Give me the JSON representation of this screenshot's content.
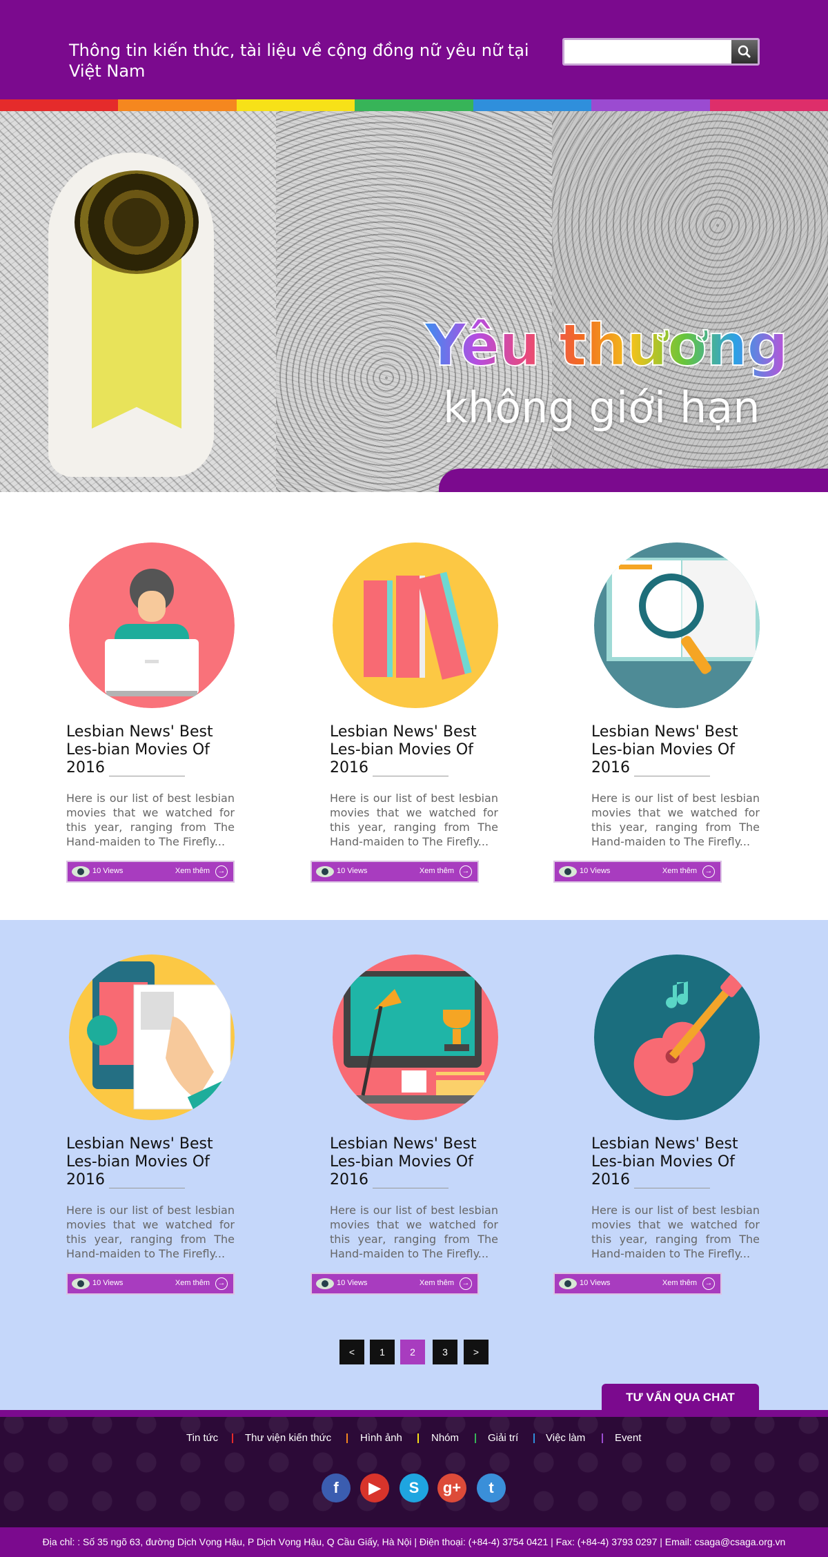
{
  "header": {
    "tagline": "Thông tin kiến thức, tài liệu về cộng đồng nữ yêu nữ tại Việt Nam",
    "search_placeholder": ""
  },
  "rainbow_colors": [
    "#e52b2b",
    "#f5871f",
    "#f7e118",
    "#37b458",
    "#2f8fdc",
    "#9b4bd1",
    "#de2e6a"
  ],
  "hero": {
    "line1": "Yêu thương",
    "line2": "không giới hạn"
  },
  "cards": [
    {
      "title": "Lesbian News' Best Les-bian Movies Of 2016",
      "desc": "Here is our list of best lesbian movies that we watched for this year, ranging from The Hand-maiden to The Firefly...",
      "views": "10 Views",
      "more": "Xem thêm",
      "icon": "woman-laptop-icon"
    },
    {
      "title": "Lesbian News' Best Les-bian Movies Of 2016",
      "desc": "Here is our list of best lesbian movies that we watched for this year, ranging from The Hand-maiden to The Firefly...",
      "views": "10 Views",
      "more": "Xem thêm",
      "icon": "books-icon"
    },
    {
      "title": "Lesbian News' Best Les-bian Movies Of 2016",
      "desc": "Here is our list of best lesbian movies that we watched for this year, ranging from The Hand-maiden to The Firefly...",
      "views": "10 Views",
      "more": "Xem thêm",
      "icon": "book-magnifier-icon"
    },
    {
      "title": "Lesbian News' Best Les-bian Movies Of 2016",
      "desc": "Here is our list of best lesbian movies that we watched for this year, ranging from The Hand-maiden to The Firefly...",
      "views": "10 Views",
      "more": "Xem thêm",
      "icon": "mobile-touch-icon"
    },
    {
      "title": "Lesbian News' Best Les-bian Movies Of 2016",
      "desc": "Here is our list of best lesbian movies that we watched for this year, ranging from The Hand-maiden to The Firefly...",
      "views": "10 Views",
      "more": "Xem thêm",
      "icon": "desk-monitor-trophy-icon"
    },
    {
      "title": "Lesbian News' Best Les-bian Movies Of 2016",
      "desc": "Here is our list of best lesbian movies that we watched for this year, ranging from The Hand-maiden to The Firefly...",
      "views": "10 Views",
      "more": "Xem thêm",
      "icon": "guitar-icon"
    }
  ],
  "pagination": {
    "prev": "<",
    "pages": [
      "1",
      "2",
      "3"
    ],
    "current": "2",
    "next": ">"
  },
  "chat": {
    "label": "TƯ VẤN QUA CHAT"
  },
  "footer": {
    "nav": [
      "Tin tức",
      "Thư viện kiến thức",
      "Hình ảnh",
      "Nhóm",
      "Giải trí",
      "Việc làm",
      "Event"
    ],
    "separator_colors": [
      "#e52b2b",
      "#f5871f",
      "#f7e118",
      "#37b458",
      "#2f8fdc",
      "#9b4bd1"
    ],
    "social": [
      {
        "name": "facebook-icon",
        "glyph": "f",
        "color": "#3b5db0"
      },
      {
        "name": "youtube-icon",
        "glyph": "▶",
        "color": "#d8342b"
      },
      {
        "name": "skype-icon",
        "glyph": "S",
        "color": "#1fa5e0"
      },
      {
        "name": "google-plus-icon",
        "glyph": "g+",
        "color": "#dd4b39"
      },
      {
        "name": "twitter-icon",
        "glyph": "t",
        "color": "#3a8fd9"
      }
    ],
    "address": "Địa chỉ: : Số 35 ngõ 63, đường Dịch Vọng Hậu, P Dịch Vọng Hậu, Q Cầu Giấy, Hà Nội  |  Điện thoại: (+84-4) 3754 0421  |  Fax: (+84-4) 3793 0297  |  Email: csaga@csaga.org.vn"
  }
}
